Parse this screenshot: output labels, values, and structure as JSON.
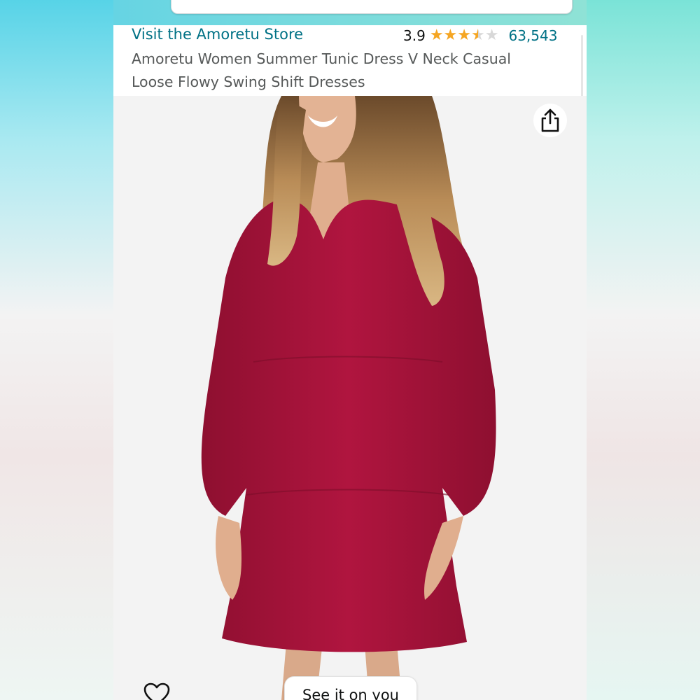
{
  "store": {
    "link_label": "Visit the Amoretu Store"
  },
  "rating": {
    "value": "3.9",
    "stars_out_of_5": 3.9,
    "count": "63,543"
  },
  "product": {
    "title": "Amoretu Women Summer Tunic Dress V Neck Casual Loose Flowy Swing Shift Dresses"
  },
  "image": {
    "alt": "woman wearing long-sleeve red tiered tunic dress",
    "dress_color": "#a9123a"
  },
  "actions": {
    "share_icon": "share-icon",
    "wishlist_icon": "heart-icon",
    "see_it_label": "See it on you"
  },
  "colors": {
    "link": "#007185",
    "star": "#f5a623",
    "header_gradient_start": "#66d4e3"
  }
}
